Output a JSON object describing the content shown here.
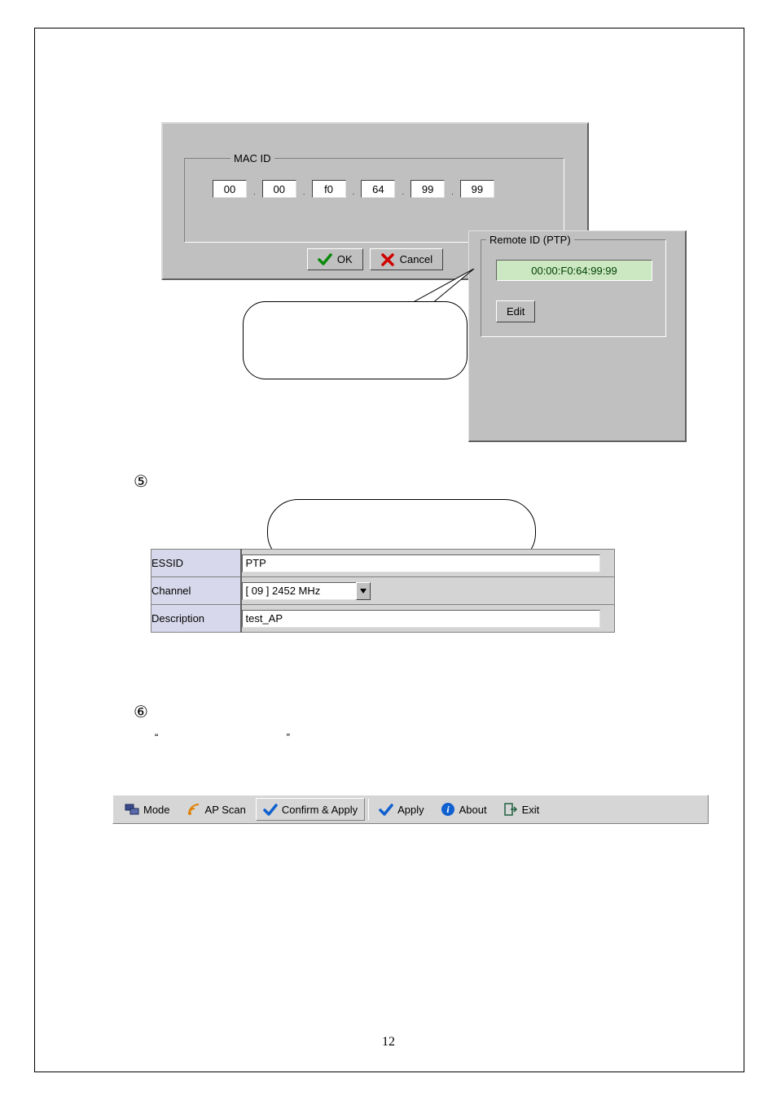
{
  "page_number": "12",
  "mac_dialog": {
    "legend": "MAC ID",
    "fields": [
      "00",
      "00",
      "f0",
      "64",
      "99",
      "99"
    ],
    "ok_label": "OK",
    "cancel_label": "Cancel"
  },
  "remote_panel": {
    "legend": "Remote ID (PTP)",
    "value": "00:00:F0:64:99:99",
    "edit_label": "Edit"
  },
  "markers": {
    "five": "⑤",
    "six": "⑥",
    "open_quote": "“",
    "close_quote": "”"
  },
  "settings": {
    "rows": [
      {
        "label": "ESSID",
        "value": "PTP",
        "type": "text"
      },
      {
        "label": "Channel",
        "value": "[ 09 ] 2452 MHz",
        "type": "select"
      },
      {
        "label": "Description",
        "value": "test_AP",
        "type": "text"
      }
    ]
  },
  "toolbar": {
    "mode": "Mode",
    "apscan": "AP Scan",
    "confirm_apply": "Confirm & Apply",
    "apply": "Apply",
    "about": "About",
    "exit": "Exit"
  }
}
